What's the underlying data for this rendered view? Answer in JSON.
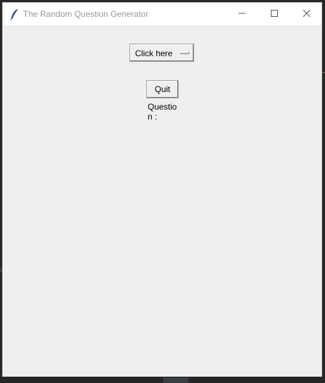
{
  "window": {
    "title": "The Random Question Generator",
    "icons": {
      "app": "feather-icon",
      "minimize": "minimize-icon",
      "maximize": "maximize-icon",
      "close": "close-icon"
    }
  },
  "main": {
    "menu_button_label": "Click here",
    "quit_label": "Quit",
    "question_label": "Question :"
  },
  "colors": {
    "window_bg": "#efefef",
    "titlebar_bg": "#ffffff",
    "title_text": "#999999"
  }
}
